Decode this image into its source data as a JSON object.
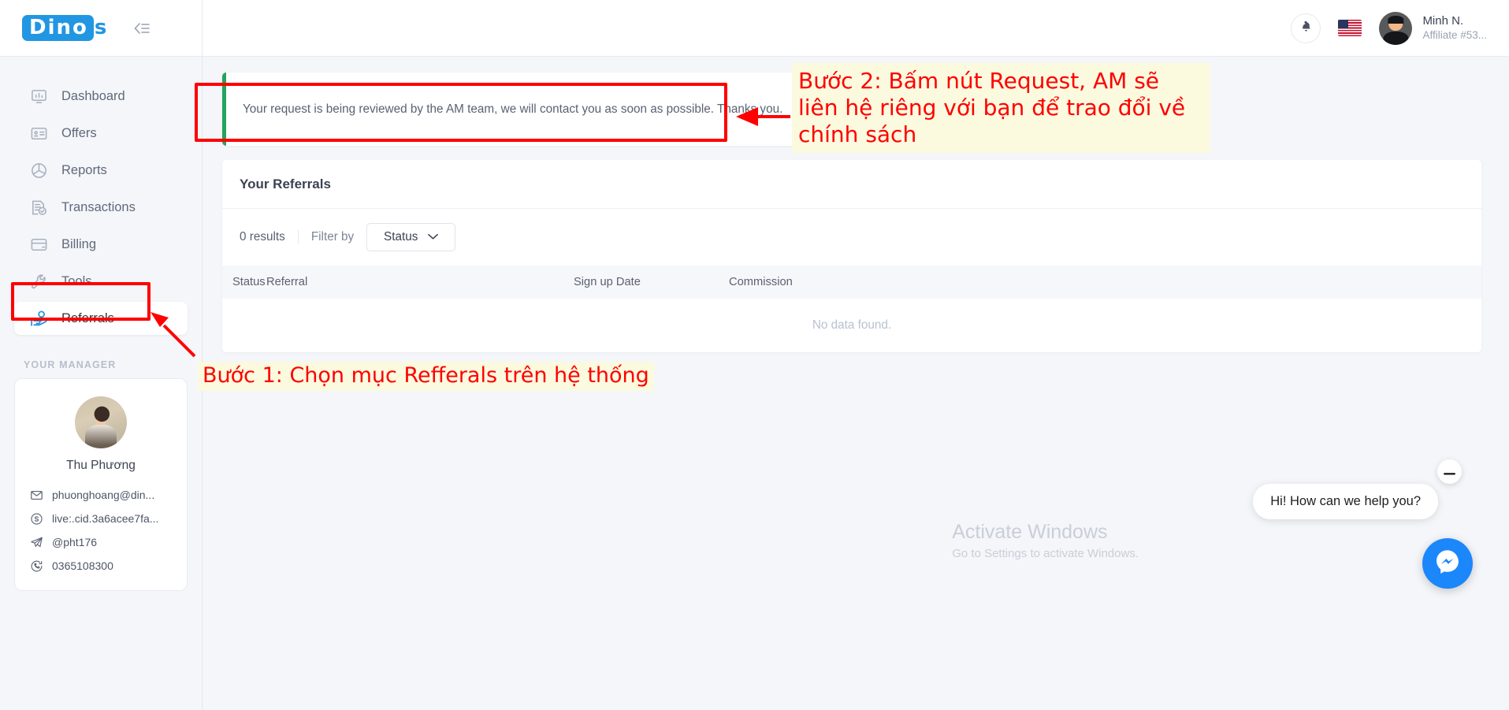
{
  "brand": {
    "logo_main": "Dino",
    "logo_suffix": "s",
    "accent": "#2196e3"
  },
  "sidebar": {
    "items": [
      {
        "label": "Dashboard",
        "icon": "dashboard-icon",
        "active": false
      },
      {
        "label": "Offers",
        "icon": "offers-icon",
        "active": false
      },
      {
        "label": "Reports",
        "icon": "reports-icon",
        "active": false
      },
      {
        "label": "Transactions",
        "icon": "transactions-icon",
        "active": false
      },
      {
        "label": "Billing",
        "icon": "billing-icon",
        "active": false
      },
      {
        "label": "Tools",
        "icon": "tools-icon",
        "active": false
      },
      {
        "label": "Referrals",
        "icon": "referrals-icon",
        "active": true
      }
    ],
    "manager_label": "YOUR MANAGER",
    "manager": {
      "name": "Thu Phương",
      "contacts": [
        {
          "icon": "mail-icon",
          "value": "phuonghoang@din..."
        },
        {
          "icon": "skype-icon",
          "value": "live:.cid.3a6acee7fa..."
        },
        {
          "icon": "telegram-icon",
          "value": "@pht176"
        },
        {
          "icon": "whatsapp-icon",
          "value": "0365108300"
        }
      ]
    }
  },
  "topbar": {
    "notifications_icon": "bell-icon",
    "language_icon": "us-flag-icon",
    "user": {
      "name": "Minh N.",
      "subtitle": "Affiliate #53..."
    }
  },
  "alert": {
    "message": "Your request is being reviewed by the AM team, we will contact you as soon as possible. Thanks you.",
    "status_color": "#22a45d"
  },
  "referrals_card": {
    "title": "Your Referrals",
    "results_count": "0 results",
    "filter_label": "Filter by",
    "status_select": {
      "value": "Status",
      "chevron": "chevron-down-icon"
    },
    "columns": [
      "Status",
      "Referral",
      "Sign up Date",
      "Commission"
    ],
    "empty_message": "No data found."
  },
  "annotations": {
    "color": "#ff0000",
    "highlight_bg": "#fbfadf",
    "step1": "Bước 1: Chọn mục Refferals trên hệ thống",
    "step2_line1": "Bước 2: Bấm nút Request, AM sẽ",
    "step2_line2": "liên hệ riêng với bạn để trao đổi về",
    "step2_line3": "chính sách"
  },
  "chat": {
    "greeting": "Hi! How can we help you?",
    "minimize_icon": "minus-icon",
    "launcher_icon": "messenger-icon"
  },
  "watermark": {
    "line1": "Activate Windows",
    "line2": "Go to Settings to activate Windows."
  }
}
